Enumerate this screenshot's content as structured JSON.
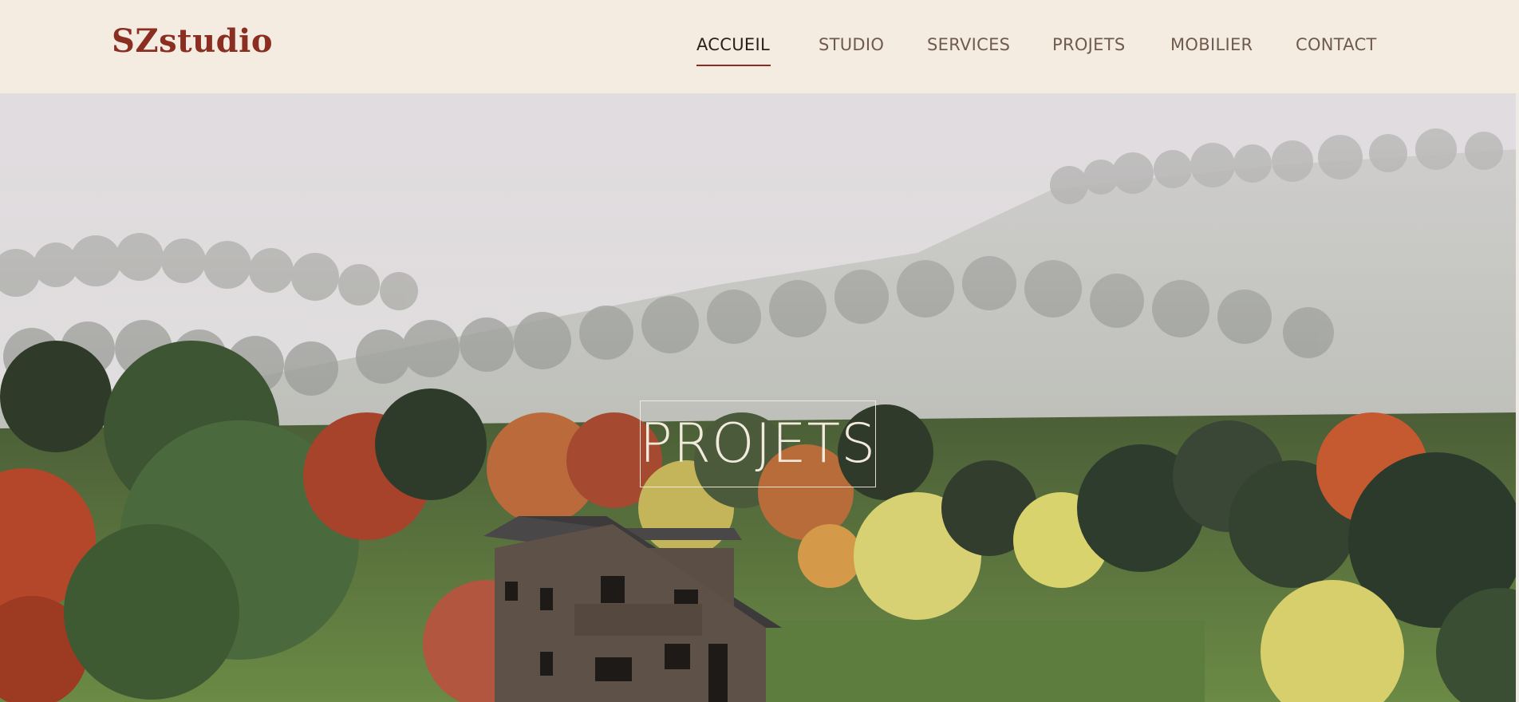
{
  "header": {
    "logo": "SZstudio",
    "nav": [
      {
        "label": "ACCUEIL",
        "active": true
      },
      {
        "label": "STUDIO",
        "active": false
      },
      {
        "label": "SERVICES",
        "active": false
      },
      {
        "label": "PROJETS",
        "active": false
      },
      {
        "label": "MOBILIER",
        "active": false
      },
      {
        "label": "CONTACT",
        "active": false
      }
    ]
  },
  "hero": {
    "title": "PROJETS",
    "image": "misty-forest-with-wooden-house"
  },
  "colors": {
    "background": "#f4ece0",
    "brand": "#8b2e22",
    "nav_text": "#6f5b4e",
    "nav_active": "#2a1f19",
    "hero_title": "#f2ebdd"
  }
}
